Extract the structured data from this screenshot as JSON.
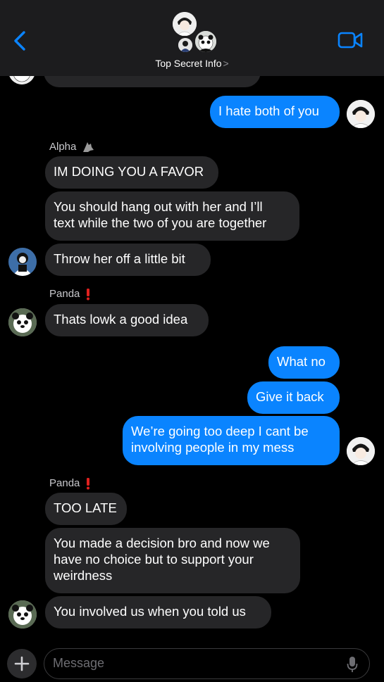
{
  "header": {
    "group_name": "Top Secret Info",
    "chevron": ">"
  },
  "messages": [
    {
      "dir": "out",
      "text": "I hate both of you"
    },
    {
      "sender": "Alpha",
      "dir": "in",
      "text": "IM DOING YOU A FAVOR"
    },
    {
      "dir": "in",
      "text": "You should hang out with her and I’ll\ntext while the two of you are together"
    },
    {
      "dir": "in",
      "text": "Throw her off a little bit"
    },
    {
      "sender": "Panda",
      "dir": "in",
      "text": "Thats lowk a good idea"
    },
    {
      "dir": "out",
      "text": "What no"
    },
    {
      "dir": "out",
      "text": "Give it back"
    },
    {
      "dir": "out",
      "text": "We’re going too deep I cant be\ninvolving people in my mess"
    },
    {
      "sender": "Panda",
      "dir": "in",
      "text": "TOO LATE"
    },
    {
      "dir": "in",
      "text": "You made a decision bro and now we\nhave no choice but to support your\nweirdness"
    },
    {
      "dir": "in",
      "text": "You involved us when you told us"
    }
  ],
  "compose": {
    "placeholder": "Message"
  },
  "colors": {
    "outgoing_bubble": "#0a84ff",
    "incoming_bubble": "#262628",
    "accent": "#0a84ff"
  }
}
